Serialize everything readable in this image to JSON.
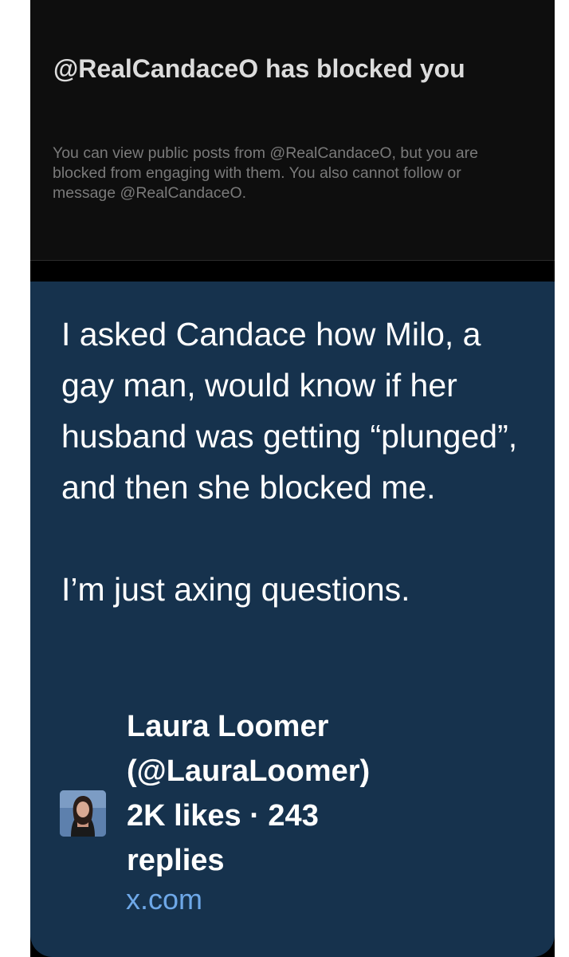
{
  "blocked_notice": {
    "title": "@RealCandaceO has blocked you",
    "description": "You can view public posts from @RealCandaceO, but you are blocked from engaging with them. You also cannot follow or message @RealCandaceO."
  },
  "post": {
    "paragraph_1": "I asked Candace how Milo, a gay man, would know if her husband was getting “plunged”, and then she blocked me.",
    "paragraph_2": "I’m just axing questions."
  },
  "author": {
    "name": "Laura Loomer",
    "handle": "(@LauraLoomer)",
    "stats": "2K likes · 243",
    "stats_cont": "replies"
  },
  "link": {
    "label": "x.com"
  }
}
